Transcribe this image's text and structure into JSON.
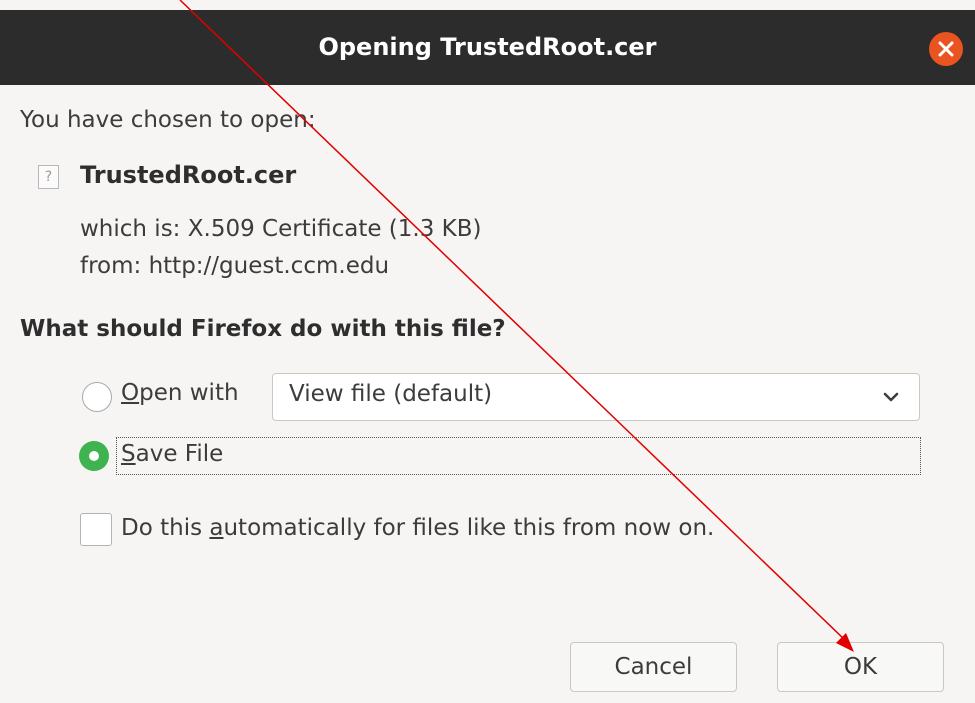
{
  "dialog": {
    "title": "Opening TrustedRoot.cer",
    "chosen_label": "You have chosen to open:",
    "file_icon_glyph": "?",
    "filename": "TrustedRoot.cer",
    "which_is": "which is: X.509 Certificate (1.3 KB)",
    "from": "from: http://guest.ccm.edu",
    "question": "What should Firefox do with this file?",
    "open_with": {
      "mnemonic": "O",
      "rest": "pen with",
      "selected": false,
      "select_value": "View file (default)"
    },
    "save_file": {
      "mnemonic": "S",
      "rest": "ave File",
      "selected": true
    },
    "auto": {
      "before": "Do this ",
      "mnemonic": "a",
      "after": "utomatically for files like this from now on.",
      "checked": false
    },
    "buttons": {
      "cancel": "Cancel",
      "ok": "OK"
    }
  },
  "colors": {
    "titlebar": "#2c2c2c",
    "close": "#e95420",
    "radio_selected": "#3eb34f",
    "annotation_arrow": "#e00000"
  },
  "icons": {
    "close": "close-icon",
    "file": "unknown-file-icon",
    "dropdown": "chevron-down-icon"
  }
}
